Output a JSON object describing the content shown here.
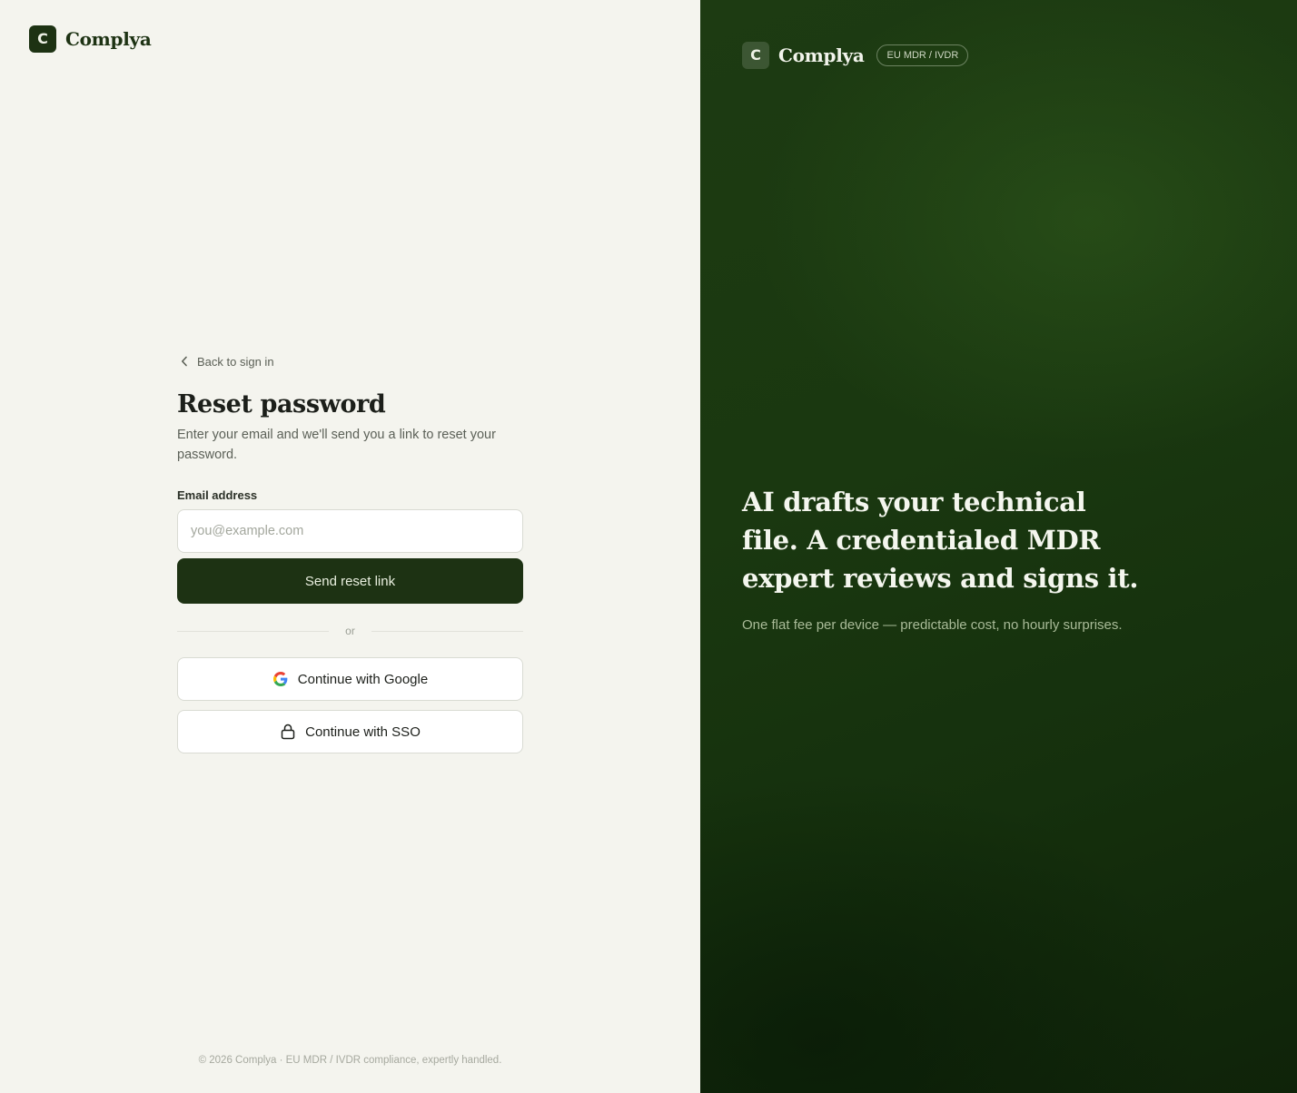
{
  "brand": {
    "logo_letter": "C",
    "name": "Complya",
    "badge": "EU MDR / IVDR"
  },
  "form": {
    "back_link": "Back to sign in",
    "title": "Reset password",
    "subtitle": "Enter your email and we'll send you a link to reset your password.",
    "email_label": "Email address",
    "email_value": "",
    "email_placeholder": "you@example.com",
    "submit_label": "Send reset link",
    "divider_text": "or",
    "google_label": "Continue with Google",
    "sso_label": "Continue with SSO"
  },
  "footer": {
    "text": "© 2026 Complya · EU MDR / IVDR compliance, expertly handled."
  },
  "hero": {
    "headline": "AI drafts your technical file. A credentialed MDR expert reviews and signs it.",
    "tagline": "One flat fee per device — predictable cost, no hourly surprises."
  },
  "icons": {
    "back": "chevron-left-icon",
    "google": "google-icon",
    "sso": "lock-icon"
  },
  "colors": {
    "primary": "#1d3213",
    "left_background": "#f4f4ee",
    "right_background": "#1a3810",
    "accent_text": "#a9bb98"
  }
}
